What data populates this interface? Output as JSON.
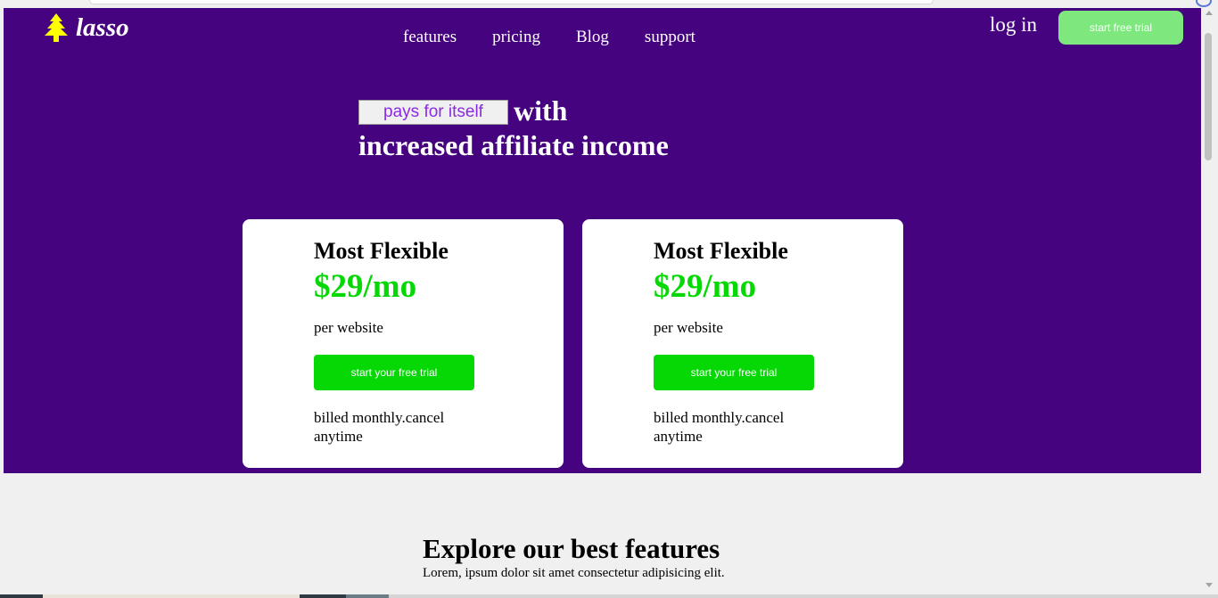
{
  "brand": {
    "name": "lasso",
    "logo_icon": "tree-icon",
    "logo_color": "#ffff00"
  },
  "nav": {
    "items": [
      "features",
      "pricing",
      "Blog",
      "support"
    ]
  },
  "header": {
    "login_label": "log in",
    "cta_label": "start free trial"
  },
  "hero": {
    "typed_word": "pays for itself",
    "line1_rest": "with",
    "line2": "increased affiliate income"
  },
  "pricing": {
    "cards": [
      {
        "plan": "Most Flexible",
        "price": "$29/mo",
        "unit": "per website",
        "cta": "start your free trial",
        "billing": "billed monthly.cancel anytime"
      },
      {
        "plan": "Most Flexible",
        "price": "$29/mo",
        "unit": "per website",
        "cta": "start your free trial",
        "billing": "billed monthly.cancel anytime"
      }
    ]
  },
  "features": {
    "title": "Explore our best features",
    "subtitle": "Lorem, ipsum dolor sit amet consectetur adipisicing elit."
  },
  "colors": {
    "hero_bg": "#460380",
    "accent_green": "#06d806",
    "header_cta": "#7ee87e",
    "typed_text": "#8a2be2",
    "page_bg": "#f0f0f0"
  }
}
